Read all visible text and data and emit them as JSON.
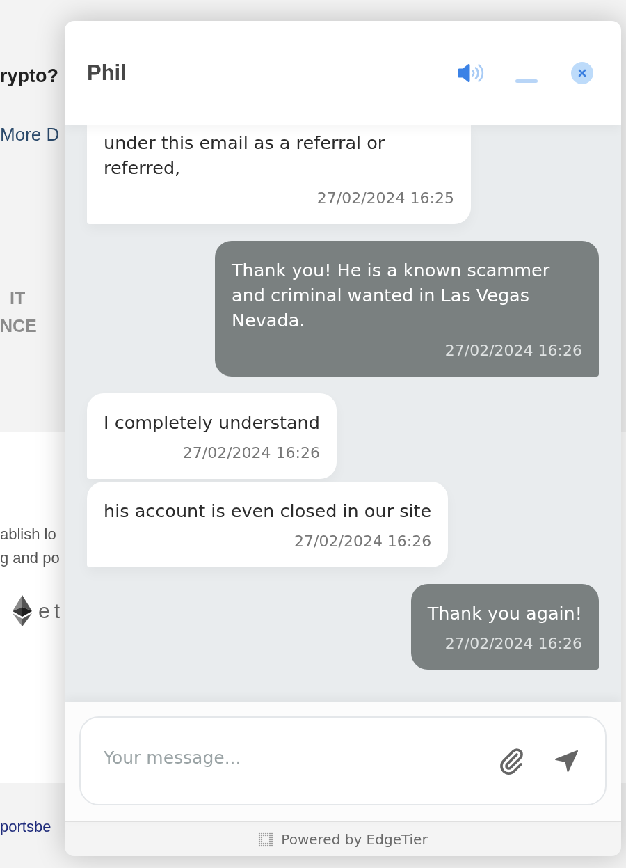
{
  "background_page": {
    "heading": "rypto?",
    "link": "More D",
    "banner_lines": [
      "IT",
      "NCE"
    ],
    "text_lines": [
      "ablish lo",
      "g and po"
    ],
    "logo_text": "et",
    "footer_link": "portsbe"
  },
  "chat": {
    "title": "Phil",
    "sound_on": true,
    "messages": [
      {
        "kind": "incoming",
        "text": "under this email as a referral or referred,",
        "time": "27/02/2024 16:25"
      },
      {
        "kind": "outgoing",
        "text": "Thank you! He is a known scammer and criminal wanted in Las Vegas Nevada.",
        "time": "27/02/2024 16:26"
      },
      {
        "kind": "incoming",
        "text": "I completely understand",
        "time": "27/02/2024 16:26"
      },
      {
        "kind": "incoming",
        "text": "his account is even closed in our site",
        "time": "27/02/2024 16:26"
      },
      {
        "kind": "outgoing",
        "text": "Thank you again!",
        "time": "27/02/2024 16:26"
      }
    ],
    "composer": {
      "placeholder": "Your message..."
    },
    "footer": "Powered by EdgeTier"
  }
}
